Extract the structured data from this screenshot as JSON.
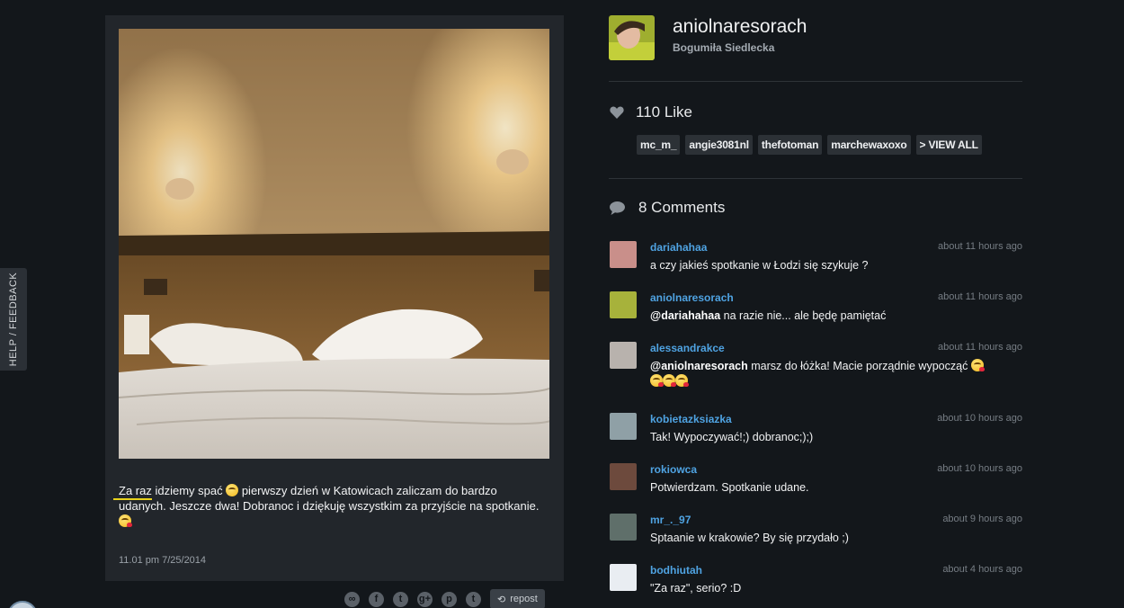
{
  "help_tab": {
    "label": "HELP / FEEDBACK"
  },
  "post": {
    "caption_lead": "Za raz",
    "caption_part1": " idziemy spać ",
    "caption_part2": " pierwszy dzień w Katowicach zaliczam do bardzo udanych. Jeszcze dwa! Dobranoc i dziękuję wszystkim za przyjście na spotkanie. ",
    "date": "11.01 pm 7/25/2014",
    "image_description": "hotel room bed with pillows and two wall lamps"
  },
  "share": {
    "icons": [
      "link-icon",
      "facebook-icon",
      "twitter-icon",
      "google-plus-icon",
      "pinterest-icon",
      "tumblr-icon"
    ],
    "glyphs": [
      "∞",
      "f",
      "t",
      "g+",
      "p",
      "t"
    ],
    "repost_label": "repost"
  },
  "profile": {
    "username": "aniolnaresorach",
    "full_name": "Bogumiła Siedlecka"
  },
  "likes": {
    "count_label": "110 Like",
    "users": [
      "mc_m_",
      "angie3081nl",
      "thefotoman",
      "marchewaxoxo"
    ],
    "view_all_label": "> VIEW ALL"
  },
  "comments": {
    "count_label": "8 Comments",
    "items": [
      {
        "user": "dariahahaa",
        "time": "about 11 hours ago",
        "mention": "",
        "text": "a czy jakieś spotkanie w Łodzi się szykuje ?",
        "avatar_color": "#c98f8a"
      },
      {
        "user": "aniolnaresorach",
        "time": "about 11 hours ago",
        "mention": "@dariahahaa",
        "text": " na razie nie... ale będę pamiętać",
        "avatar_color": "#a7b23b"
      },
      {
        "user": "alessandrakce",
        "time": "about 11 hours ago",
        "mention": "@aniolnaresorach",
        "text": " marsz do łóżka! Macie porządnie wypocząć",
        "avatar_color": "#b8b2ad"
      },
      {
        "user": "kobietazksiazka",
        "time": "about 10 hours ago",
        "mention": "",
        "text": "Tak! Wypoczywać!;) dobranoc;);)",
        "avatar_color": "#8fa0a6"
      },
      {
        "user": "rokiowca",
        "time": "about 10 hours ago",
        "mention": "",
        "text": "Potwierdzam. Spotkanie udane.",
        "avatar_color": "#6d4a3d"
      },
      {
        "user": "mr_._97",
        "time": "about 9 hours ago",
        "mention": "",
        "text": "Sptaanie w krakowie? By się przydało ;)",
        "avatar_color": "#5f6f6a"
      },
      {
        "user": "bodhiutah",
        "time": "about 4 hours ago",
        "mention": "",
        "text": "\"Za raz\", serio? :D",
        "avatar_color": "#e9edf2"
      }
    ]
  }
}
